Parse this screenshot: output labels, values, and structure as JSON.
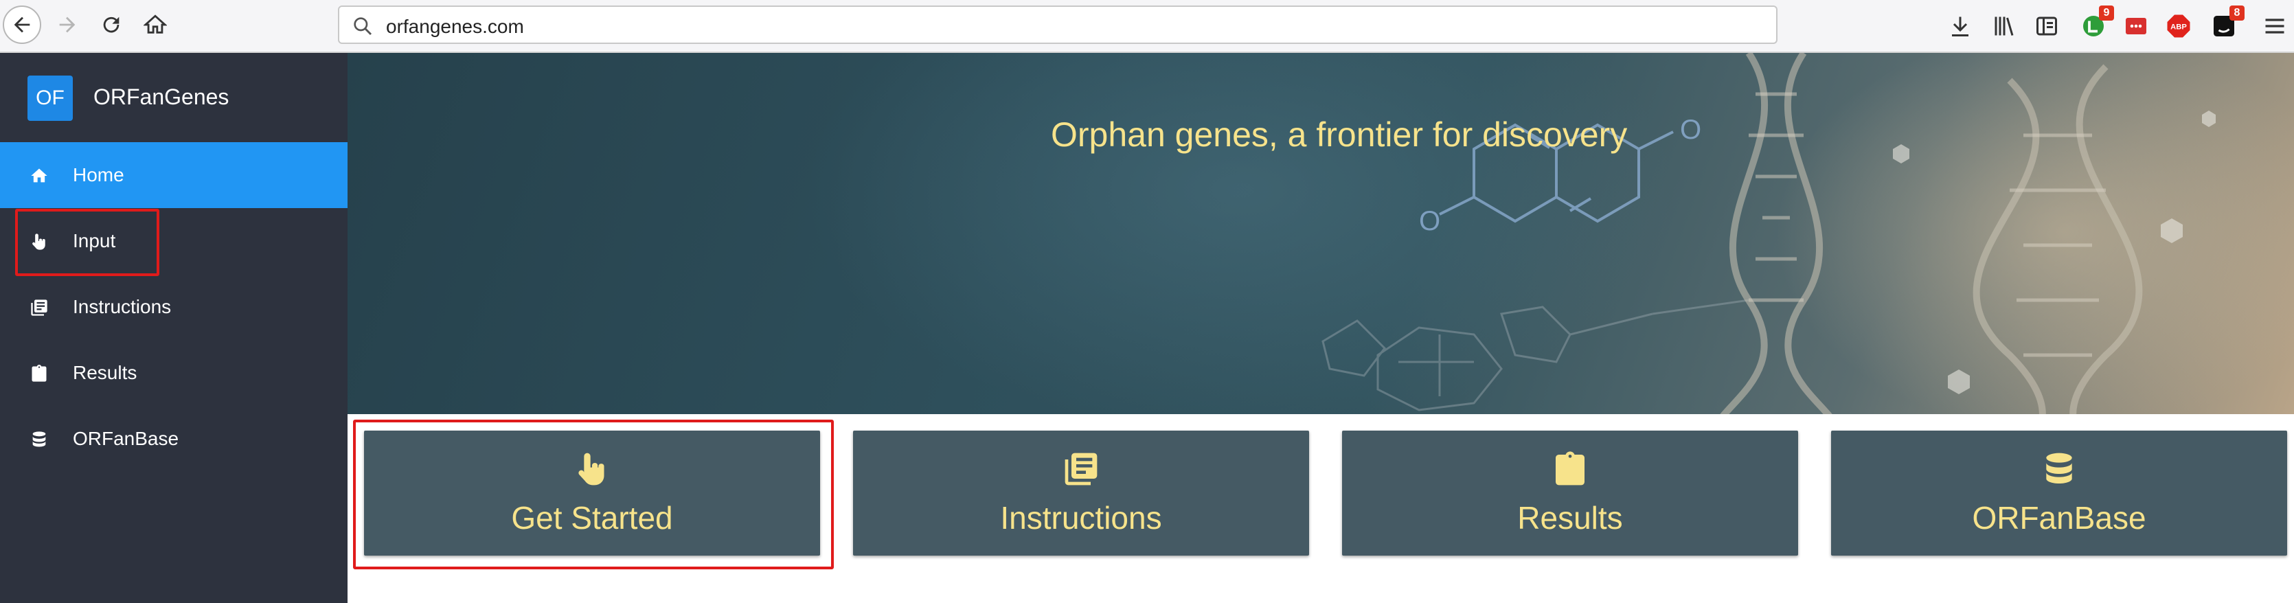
{
  "browser": {
    "url": "orfangenes.com",
    "toolbar_icons": [
      "download-icon",
      "library-icon",
      "reader-view-icon",
      "extension-green-icon",
      "extension-red-icon",
      "adblock-icon",
      "extension-dark-icon",
      "menu-icon"
    ],
    "badges": {
      "green_extension": "9",
      "dark_extension": "8"
    },
    "adblock_label": "ABP"
  },
  "sidebar": {
    "logo_text": "OF",
    "brand_name": "ORFanGenes",
    "items": [
      {
        "label": "Home",
        "icon": "home-icon",
        "active": true
      },
      {
        "label": "Input",
        "icon": "pointer-hand-icon",
        "active": false
      },
      {
        "label": "Instructions",
        "icon": "instructions-icon",
        "active": false
      },
      {
        "label": "Results",
        "icon": "clipboard-icon",
        "active": false
      },
      {
        "label": "ORFanBase",
        "icon": "database-icon",
        "active": false
      }
    ]
  },
  "hero": {
    "title": "Orphan genes, a frontier for discovery"
  },
  "cards": [
    {
      "label": "Get Started",
      "icon": "pointer-hand-icon"
    },
    {
      "label": "Instructions",
      "icon": "instructions-icon"
    },
    {
      "label": "Results",
      "icon": "clipboard-icon"
    },
    {
      "label": "ORFanBase",
      "icon": "database-icon"
    }
  ],
  "colors": {
    "sidebar_bg": "#2d323e",
    "active_item": "#2196f3",
    "card_bg": "#455a64",
    "accent_text": "#f7e38b",
    "highlight": "#e01b1b"
  }
}
